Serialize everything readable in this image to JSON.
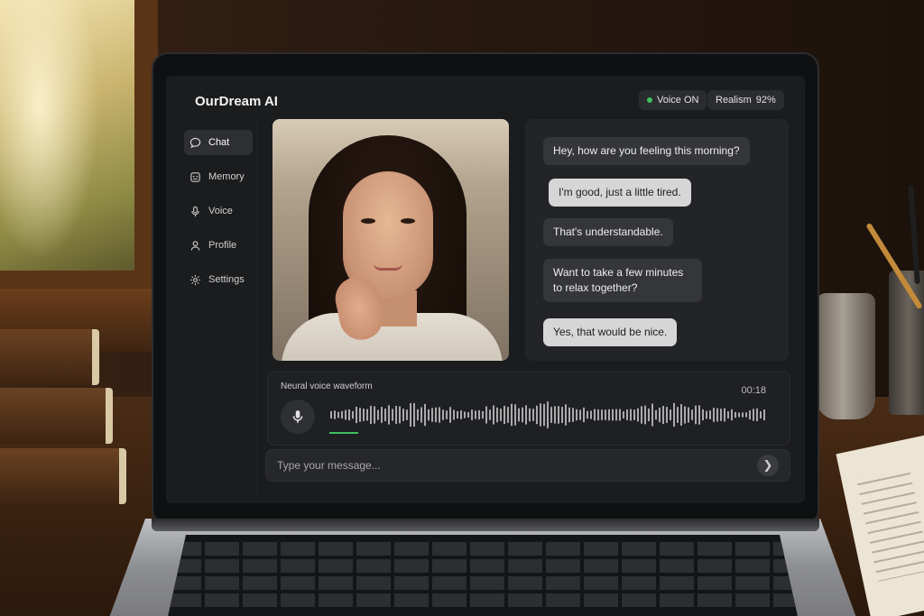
{
  "app": {
    "title": "OurDream AI"
  },
  "status": {
    "voice_label": "Voice ON",
    "voice_color": "#3fbf5f",
    "realism_label": "Realism",
    "realism_value": "92%"
  },
  "sidebar": {
    "items": [
      {
        "label": "Chat",
        "icon": "chat-bubble-icon",
        "active": true
      },
      {
        "label": "Memory",
        "icon": "memory-icon",
        "active": false
      },
      {
        "label": "Voice",
        "icon": "microphone-icon",
        "active": false
      },
      {
        "label": "Profile",
        "icon": "user-icon",
        "active": false
      },
      {
        "label": "Settings",
        "icon": "gear-icon",
        "active": false
      }
    ]
  },
  "chat": {
    "messages": [
      {
        "sender": "ai",
        "text": "Hey, how are you feeling this morning?"
      },
      {
        "sender": "user",
        "text": "I'm good, just a little tired."
      },
      {
        "sender": "ai",
        "text": "That's understandable."
      },
      {
        "sender": "ai",
        "text": "Want to take a few minutes to relax together?"
      },
      {
        "sender": "user",
        "text": "Yes, that would be nice."
      }
    ]
  },
  "waveform": {
    "label": "Neural voice waveform",
    "time": "00:18",
    "progress": 0.2,
    "accent_color": "#3fbf5f"
  },
  "composer": {
    "placeholder": "Type your message...",
    "send_icon": "send-arrow-icon"
  }
}
